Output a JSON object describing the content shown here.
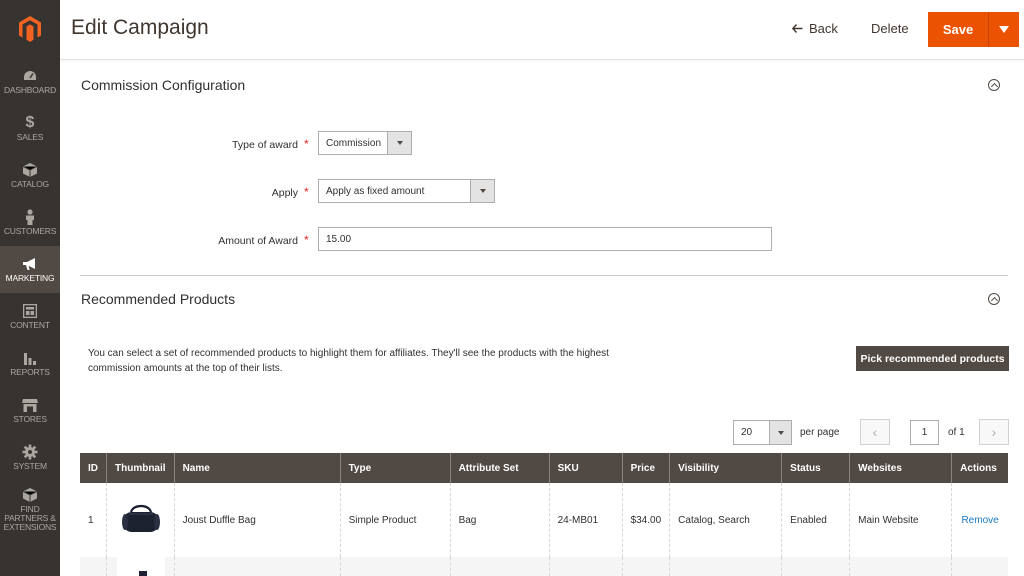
{
  "sidebar": {
    "items": [
      {
        "label": "DASHBOARD",
        "icon": "dashboard-icon"
      },
      {
        "label": "SALES",
        "icon": "dollar-icon"
      },
      {
        "label": "CATALOG",
        "icon": "box-icon"
      },
      {
        "label": "CUSTOMERS",
        "icon": "person-icon"
      },
      {
        "label": "MARKETING",
        "icon": "megaphone-icon"
      },
      {
        "label": "CONTENT",
        "icon": "layout-icon"
      },
      {
        "label": "REPORTS",
        "icon": "bar-chart-icon"
      },
      {
        "label": "STORES",
        "icon": "store-icon"
      },
      {
        "label": "SYSTEM",
        "icon": "gear-icon"
      },
      {
        "label": "FIND PARTNERS & EXTENSIONS",
        "icon": "cube-icon"
      }
    ]
  },
  "header": {
    "title": "Edit Campaign",
    "back_label": "Back",
    "delete_label": "Delete",
    "save_label": "Save"
  },
  "commission": {
    "title": "Commission Configuration",
    "type_label": "Type of award",
    "type_value": "Commission",
    "apply_label": "Apply",
    "apply_value": "Apply as fixed amount",
    "amount_label": "Amount of Award",
    "amount_value": "15.00"
  },
  "recommended": {
    "title": "Recommended Products",
    "description": "You can select a set of recommended products to highlight them for affiliates. They'll see the products with the highest commission amounts at the top of their lists.",
    "pick_label": "Pick recommended products"
  },
  "pager": {
    "page_size": "20",
    "per_page_label": "per page",
    "current_page": "1",
    "of_label": "of 1"
  },
  "table": {
    "headers": [
      "ID",
      "Thumbnail",
      "Name",
      "Type",
      "Attribute Set",
      "SKU",
      "Price",
      "Visibility",
      "Status",
      "Websites",
      "Actions"
    ],
    "rows": [
      {
        "id": "1",
        "name": "Joust Duffle Bag",
        "type": "Simple Product",
        "attribute_set": "Bag",
        "sku": "24-MB01",
        "price": "$34.00",
        "visibility": "Catalog, Search",
        "status": "Enabled",
        "websites": "Main Website",
        "action": "Remove"
      }
    ]
  },
  "colors": {
    "accent": "#eb5202",
    "sidebar": "#373330",
    "sidebar_active": "#514943",
    "table_header": "#514943",
    "link": "#1979c3"
  }
}
